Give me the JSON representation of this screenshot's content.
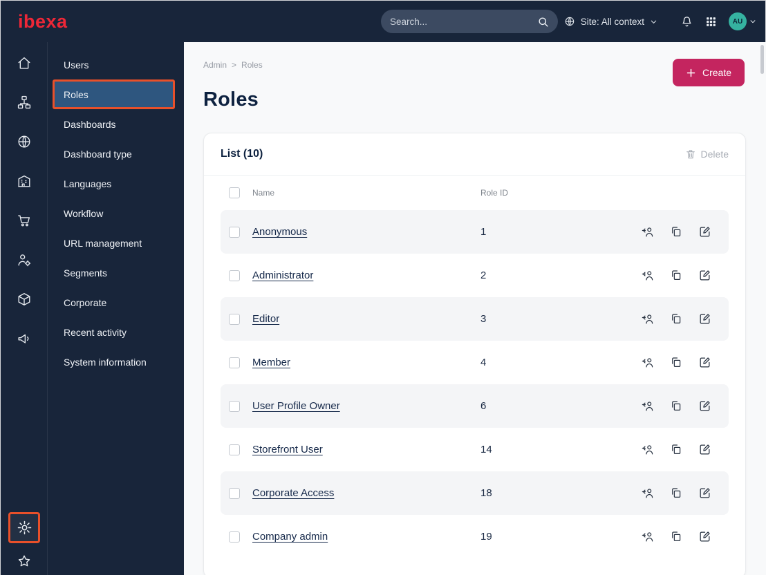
{
  "topbar": {
    "logo_text": "ibexa",
    "search_placeholder": "Search...",
    "site_context_label": "Site: All context",
    "avatar_initials": "AU"
  },
  "icon_rail": {
    "items": [
      "home",
      "content-tree",
      "site-globe",
      "company-building",
      "commerce-cart",
      "customer-settings",
      "product-catalog",
      "marketing-megaphone"
    ],
    "bottom_items": [
      "settings-gear",
      "bookmarks-star"
    ]
  },
  "sidebar": {
    "items": [
      {
        "label": "Users",
        "state": ""
      },
      {
        "label": "Roles",
        "state": "active"
      },
      {
        "label": "Dashboards",
        "state": ""
      },
      {
        "label": "Dashboard type",
        "state": ""
      },
      {
        "label": "Languages",
        "state": ""
      },
      {
        "label": "Workflow",
        "state": ""
      },
      {
        "label": "URL management",
        "state": ""
      },
      {
        "label": "Segments",
        "state": ""
      },
      {
        "label": "Corporate",
        "state": ""
      },
      {
        "label": "Recent activity",
        "state": ""
      },
      {
        "label": "System information",
        "state": ""
      }
    ]
  },
  "main": {
    "breadcrumb": {
      "items": [
        "Admin",
        "Roles"
      ],
      "separator": ">"
    },
    "create_button": "Create",
    "page_title": "Roles",
    "list": {
      "title": "List (10)",
      "delete_button": "Delete",
      "columns": {
        "name": "Name",
        "role_id": "Role ID"
      },
      "rows": [
        {
          "name": "Anonymous",
          "role_id": "1"
        },
        {
          "name": "Administrator",
          "role_id": "2"
        },
        {
          "name": "Editor",
          "role_id": "3"
        },
        {
          "name": "Member",
          "role_id": "4"
        },
        {
          "name": "User Profile Owner",
          "role_id": "6"
        },
        {
          "name": "Storefront User",
          "role_id": "14"
        },
        {
          "name": "Corporate Access",
          "role_id": "18"
        },
        {
          "name": "Company admin",
          "role_id": "19"
        }
      ]
    }
  },
  "colors": {
    "brand_red": "#ee2737",
    "accent_highlight": "#e8502a",
    "create_button_bg": "#c4255f",
    "active_item_bg": "#2e567f",
    "topbar_bg": "#18253a",
    "avatar_bg": "#35b2a0"
  }
}
